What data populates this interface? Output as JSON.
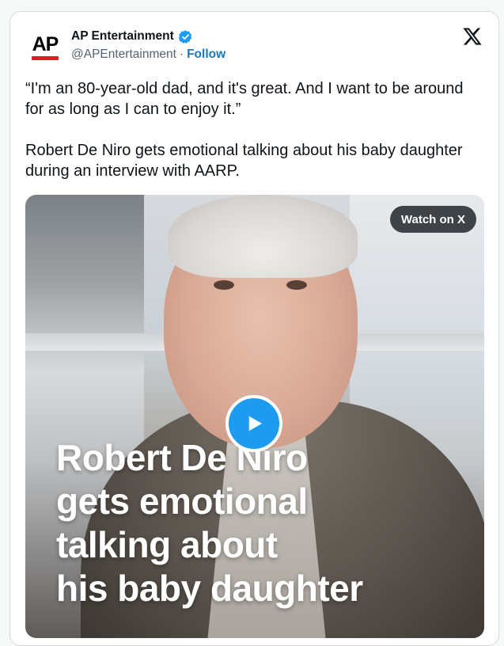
{
  "tweet": {
    "author_name": "AP Entertainment",
    "handle": "@APEntertainment",
    "separator": "·",
    "follow_label": "Follow",
    "avatar_text": "AP",
    "quote": "“I'm an 80-year-old dad, and it's great. And I want to be around for as long as I can to enjoy it.”",
    "body": "Robert De Niro gets emotional talking about his baby daughter during an interview with AARP."
  },
  "media": {
    "watch_label": "Watch on X",
    "headline_lines": [
      "Robert De Niro",
      "gets emotional",
      "talking about",
      "his baby daughter"
    ]
  },
  "icons": {
    "verified": "verified-badge-icon",
    "platform": "x-logo-icon",
    "play": "play-icon"
  },
  "colors": {
    "accent": "#1d9bf0",
    "follow": "#1d77bd",
    "ap_red": "#e21b23",
    "text": "#0f1419",
    "muted": "#536471"
  }
}
